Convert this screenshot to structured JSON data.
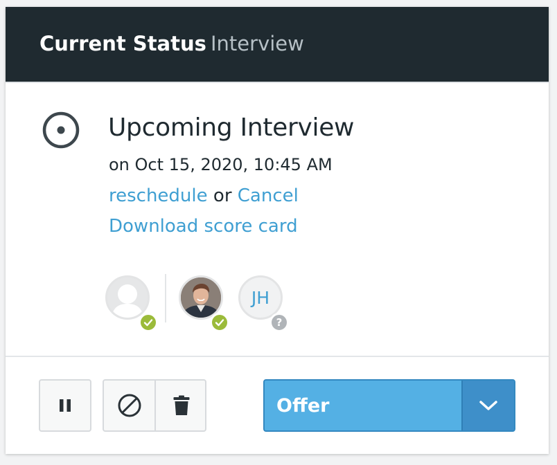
{
  "header": {
    "title": "Current Status",
    "subtitle": "Interview"
  },
  "status": {
    "icon": "radio-target-icon",
    "title": "Upcoming Interview",
    "date": "on Oct 15, 2020, 10:45 AM",
    "reschedule_label": "reschedule",
    "or_label": " or ",
    "cancel_label": "Cancel",
    "download_label": "Download score card"
  },
  "interviewers": [
    {
      "type": "placeholder-avatar",
      "status": "confirmed"
    },
    {
      "type": "photo-avatar",
      "status": "confirmed"
    },
    {
      "type": "initials-avatar",
      "initials": "JH",
      "status": "unknown",
      "status_glyph": "?"
    }
  ],
  "toolbar": {
    "pause_icon": "pause-icon",
    "reject_icon": "ban-icon",
    "delete_icon": "trash-icon",
    "primary_action": "Offer",
    "dropdown_icon": "chevron-down-icon"
  },
  "colors": {
    "header_bg": "#1f2a30",
    "link": "#3f9fd2",
    "confirmed_badge": "#9bbb3a",
    "unknown_badge": "#b0b4b8",
    "offer_button": "#54b0e4",
    "offer_toggle": "#3e8fc9"
  }
}
